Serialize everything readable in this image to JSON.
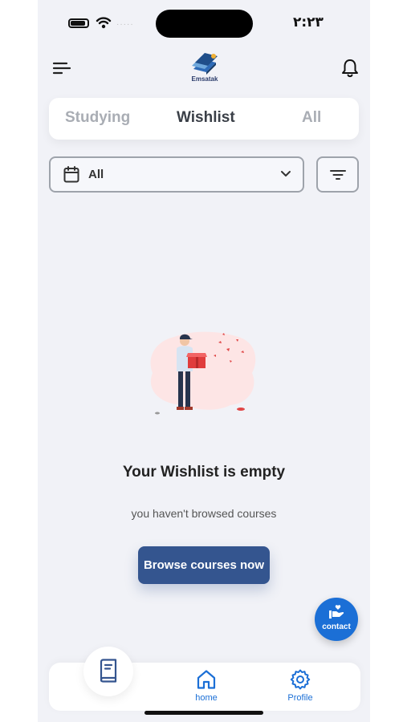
{
  "status_bar": {
    "time": "٢:٢٣",
    "signal_dots": "·····"
  },
  "header": {
    "logo_text": "Emsatak"
  },
  "tabs": [
    {
      "label": "Studying",
      "active": false
    },
    {
      "label": "Wishlist",
      "active": true
    },
    {
      "label": "All",
      "active": false
    }
  ],
  "filter": {
    "date_value": "All"
  },
  "empty_state": {
    "title": "Your Wishlist is empty",
    "subtitle": "you haven't browsed courses",
    "button_label": "Browse courses now"
  },
  "contact": {
    "label": "contact"
  },
  "bottom_nav": {
    "items": [
      {
        "label": "home",
        "icon": "home-icon"
      },
      {
        "label": "Profile",
        "icon": "gear-icon"
      }
    ]
  },
  "colors": {
    "primary": "#34558f",
    "accent": "#1b6fd6",
    "background": "#f1f2f7",
    "tab_inactive": "#a9adb4",
    "tab_active": "#3a3f47"
  }
}
